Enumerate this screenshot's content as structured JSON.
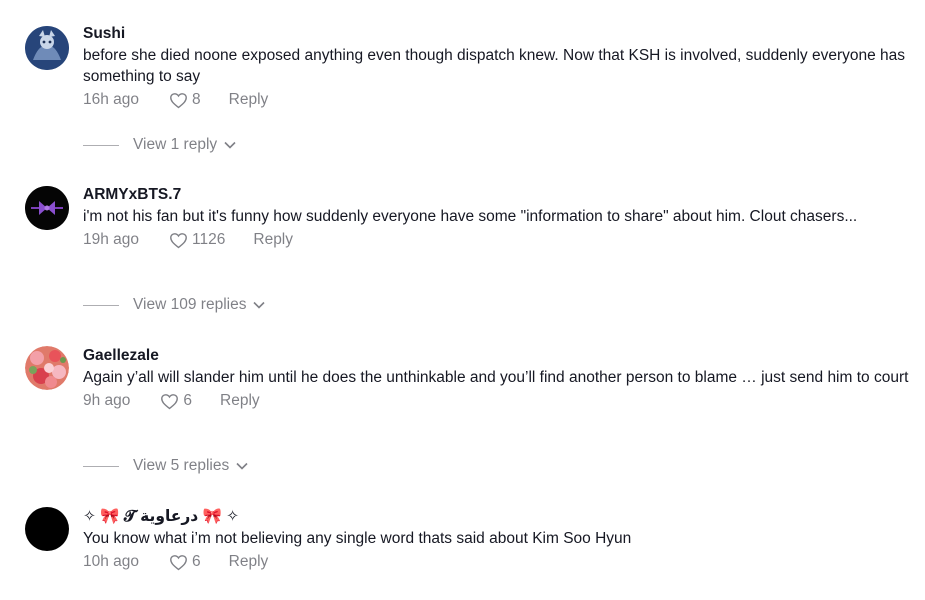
{
  "comments": [
    {
      "username": "Sushi",
      "text": "before she died noone exposed anything even though dispatch knew. Now that KSH is involved, suddenly everyone has something to say",
      "time": "16h ago",
      "likes": "8",
      "reply_label": "Reply",
      "view_replies": "View 1 reply"
    },
    {
      "username": "ARMYxBTS.7",
      "text": "i'm not his fan but it's funny how suddenly everyone have some \"information to share\" about him. Clout chasers...",
      "time": "19h ago",
      "likes": "1126",
      "reply_label": "Reply",
      "view_replies": "View 109 replies"
    },
    {
      "username": "Gaellezale",
      "text": "Again y’all will slander him until he does the unthinkable and you’ll find another person to blame … just send him to court",
      "time": "9h ago",
      "likes": "6",
      "reply_label": "Reply",
      "view_replies": "View 5 replies"
    },
    {
      "username": "✧ 🎀 𝓣 درعاوية 🎀 ✧",
      "text": "You know what i’m not believing any single word thats said about Kim Soo Hyun",
      "time": "10h ago",
      "likes": "6",
      "reply_label": "Reply"
    }
  ],
  "icons": {
    "like": "heart-outline-icon",
    "expand": "chevron-down-icon"
  },
  "colors": {
    "text_primary": "#161823",
    "text_secondary": "rgba(22,24,35,0.55)",
    "background": "#ffffff"
  }
}
